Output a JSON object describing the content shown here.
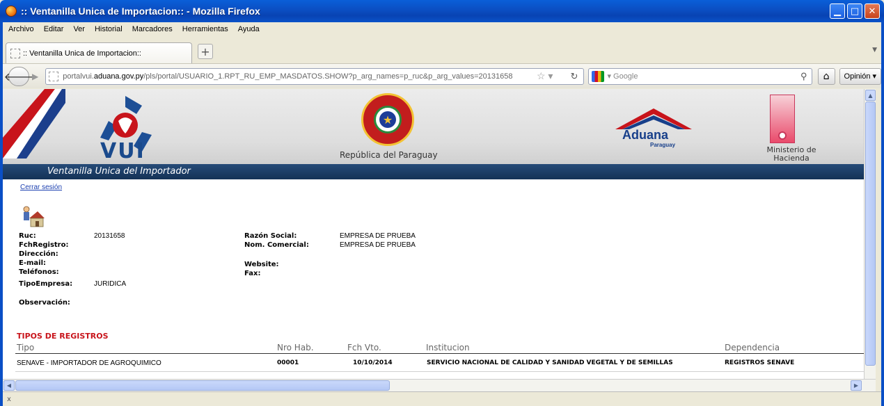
{
  "window": {
    "title": ":: Ventanilla Unica de Importacion:: - Mozilla Firefox"
  },
  "menu": {
    "items": [
      "Archivo",
      "Editar",
      "Ver",
      "Historial",
      "Marcadores",
      "Herramientas",
      "Ayuda"
    ]
  },
  "tab": {
    "label": ":: Ventanilla Unica de Importacion::",
    "new_tab": "+"
  },
  "navbar": {
    "url_prefix": "portalvui.",
    "url_domain": "aduana.gov.py",
    "url_rest": "/pls/portal/USUARIO_1.RPT_RU_EMP_MASDATOS.SHOW?p_arg_names=p_ruc&p_arg_values=20131658",
    "search_placeholder": "Google",
    "opinion_label": "Opinión"
  },
  "banner": {
    "vui_text": "VUI",
    "republic_label": "República del Paraguay",
    "aduana_text": "Aduana",
    "aduana_sub": "Paraguay",
    "ministerio_label": "Ministerio de Hacienda",
    "bar_title": "Ventanilla Unica del Importador"
  },
  "session": {
    "logout": "Cerrar sesión"
  },
  "company": {
    "ruc_label": "Ruc:",
    "ruc_value": "20131658",
    "fchregistro_label": "FchRegistro:",
    "direccion_label": "Dirección:",
    "email_label": "E-mail:",
    "telefonos_label": "Teléfonos:",
    "tipoempresa_label": "TipoEmpresa:",
    "tipoempresa_value": "JURIDICA",
    "observacion_label": "Observación:",
    "razon_label": "Razón Social:",
    "razon_value": "EMPRESA DE PRUEBA",
    "nomcomercial_label": "Nom. Comercial:",
    "nomcomercial_value": "EMPRESA DE PRUEBA",
    "website_label": "Website:",
    "fax_label": "Fax:"
  },
  "registros": {
    "title": "TIPOS DE REGISTROS",
    "headers": {
      "tipo": "Tipo",
      "nro": "Nro Hab.",
      "fch": "Fch Vto.",
      "institucion": "Institucion",
      "dependencia": "Dependencia"
    },
    "rows": [
      {
        "tipo": "SENAVE - IMPORTADOR DE AGROQUIMICO",
        "nro": "00001",
        "fch": "10/10/2014",
        "institucion": "SERVICIO NACIONAL DE CALIDAD Y SANIDAD VEGETAL Y DE SEMILLAS",
        "dependencia": "REGISTROS SENAVE"
      }
    ]
  },
  "status": {
    "text": "x"
  }
}
